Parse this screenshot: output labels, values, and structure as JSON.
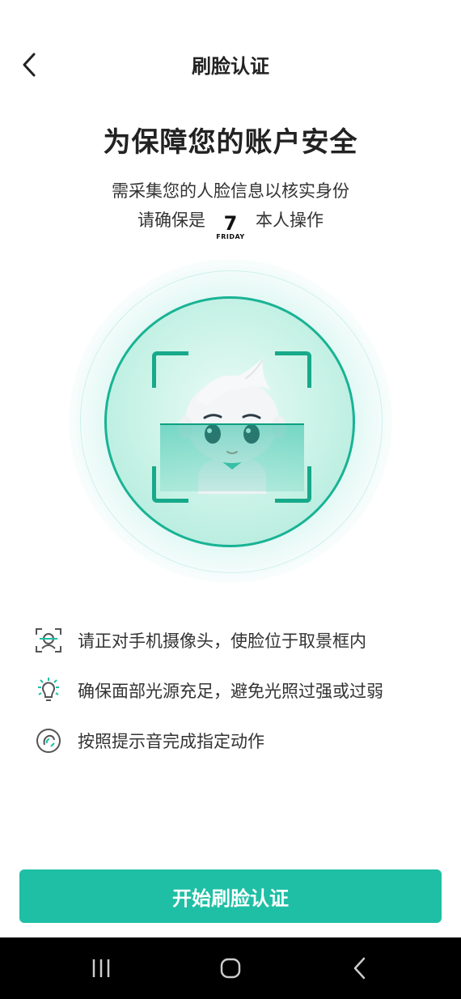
{
  "header": {
    "title": "刷脸认证",
    "back_icon": "chevron-left-icon"
  },
  "intro": {
    "title": "为保障您的账户安全",
    "subtitle": "需采集您的人脸信息以核实身份",
    "confirm_prefix": "请确保是",
    "confirm_suffix": "本人操作",
    "date_day": "7",
    "date_weekday": "FRIDAY"
  },
  "tips": [
    {
      "icon": "face-scan-icon",
      "text": "请正对手机摄像头，使脸位于取景框内"
    },
    {
      "icon": "light-bulb-icon",
      "text": "确保面部光源充足，避免光照过强或过弱"
    },
    {
      "icon": "sound-icon",
      "text": "按照提示音完成指定动作"
    }
  ],
  "start_button": {
    "label": "开始刷脸认证"
  },
  "colors": {
    "accent": "#1fbfa5",
    "frame": "#17a98a"
  },
  "nav": {
    "recent_icon": "recent-apps-icon",
    "home_icon": "home-icon",
    "back_icon": "back-icon"
  }
}
